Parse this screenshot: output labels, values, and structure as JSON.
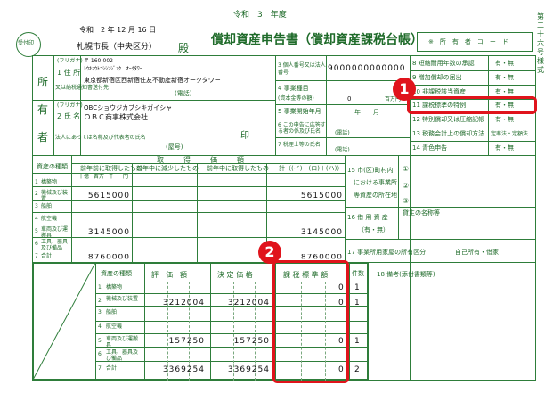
{
  "form": {
    "era_year": "令和　3　年度",
    "title": "償却資産申告書（償却資産課税台帳）",
    "date": "令和　2 年 12 月 16 日",
    "stamp": "受付印",
    "addressee": "札幌市長（中央区分）",
    "honorific": "殿",
    "owner_code_label": "※　所　有　者　コ　ー　ド",
    "side_label": "第二十六号様式"
  },
  "owner": {
    "group_chars": [
      "所",
      "有",
      "者"
    ],
    "address_label": "1 住 所",
    "address_sub": "又は納税通知書送付先",
    "address_furigana": "ﾄｳｷｮｳﾄﾆｼｼﾝｼﾞｭｸ...ｵｰｸﾀﾜｰ",
    "postal": "〒 160-002",
    "address": "東京都新宿区西新宿住友不動産新宿オークタワー",
    "phone_label": "(電話)",
    "name_label": "2 氏 名",
    "name_sub": "法人にあっては名称及び代表者の氏名",
    "name_furigana": "OBCショウジカブシキガイシャ",
    "name": "ＯＢＣ商事株式会社",
    "seal": "印",
    "trade_name_label": "(屋号)",
    "furigana_label": "(フリガナ)"
  },
  "mid": {
    "r3": "3 個人番号又は法人番号",
    "corp_number": "9000000000000",
    "r4": "4 事業種目",
    "r4_sub": "(資本金等の額)",
    "r4_value": "0",
    "r4_unit": "百万円",
    "r5": "5 事業開始年月",
    "r5_value": "年　　月",
    "r6": "6 この申告に応答する者の係及び氏名",
    "r6_sub": "(電話)",
    "r7": "7 税理士等の氏名",
    "r7_sub": "(電話)"
  },
  "right_top": [
    {
      "label": "8 短縮耐用年数の承認",
      "value": "有・無"
    },
    {
      "label": "9 増加償却の届出",
      "value": "有・無"
    },
    {
      "label": "10 非課税該当資産",
      "value": "有・無"
    },
    {
      "label": "11 課税標準の特例",
      "value": "有・無"
    },
    {
      "label": "12 特別償却又は圧縮記帳",
      "value": "有・無"
    },
    {
      "label": "13 税務会計上の償却方法",
      "value": "定率法・定額法"
    },
    {
      "label": "14 青色申告",
      "value": "有・無"
    }
  ],
  "assets": {
    "header_kind": "資産の種類",
    "header_group": "取　　得　　価　　額",
    "col1": "前年前に取得したもの",
    "col2": "前年中に減少したもの",
    "col3": "前年中に取得したもの",
    "col4": "計（(イ)－(ロ)＋(ハ)）",
    "col_marks": [
      "(イ)",
      "(ロ)",
      "(ハ)",
      "(ニ)"
    ],
    "units": [
      "十億",
      "百万",
      "千",
      "円"
    ],
    "rows": [
      {
        "no": "1",
        "kind": "構築物",
        "c1": "",
        "c4": ""
      },
      {
        "no": "2",
        "kind": "機械及び装置",
        "c1": "5615000",
        "c4": "5615000"
      },
      {
        "no": "3",
        "kind": "船舶",
        "c1": "",
        "c4": ""
      },
      {
        "no": "4",
        "kind": "航空機",
        "c1": "",
        "c4": ""
      },
      {
        "no": "5",
        "kind": "車両及び運搬具",
        "c1": "3145000",
        "c4": "3145000"
      },
      {
        "no": "6",
        "kind": "工具、器具及び備品",
        "c1": "",
        "c4": ""
      },
      {
        "no": "7",
        "kind": "合計",
        "c1": "8760000",
        "c4": "8760000"
      }
    ]
  },
  "right_mid": {
    "r15a": "15 市(区)町村内",
    "r15b": "における事業所",
    "r15c": "等資産の所在地",
    "circ1": "①",
    "circ2": "②",
    "circ3": "③",
    "r16": "16 借 用 資 産",
    "r16_value": "（有・無）",
    "r16_lessor": "貸主の名称等",
    "r17": "17 事業所用家屋の所有区分",
    "r17_value": "自己所有・借家",
    "r18": "18 備考(添付書類等)"
  },
  "lower": {
    "header_kind": "資産の種類",
    "col1": "評　価　額",
    "col2": "決 定 価 格",
    "col3": "課 税 標 準 額",
    "col4": "件数",
    "col_marks": [
      "(ホ)",
      "(ヘ)",
      "(ト)"
    ],
    "rows": [
      {
        "no": "1",
        "kind": "構築物",
        "v1": "",
        "v2": "",
        "v3": "0",
        "n": "1"
      },
      {
        "no": "2",
        "kind": "機械及び装置",
        "v1": "3212004",
        "v2": "3212004",
        "v3": "0",
        "n": "1"
      },
      {
        "no": "3",
        "kind": "船舶",
        "v1": "",
        "v2": "",
        "v3": "",
        "n": ""
      },
      {
        "no": "4",
        "kind": "航空機",
        "v1": "",
        "v2": "",
        "v3": "",
        "n": ""
      },
      {
        "no": "5",
        "kind": "車両及び運搬具",
        "v1": "157250",
        "v2": "157250",
        "v3": "0",
        "n": "1"
      },
      {
        "no": "6",
        "kind": "工具、器具及び備品",
        "v1": "",
        "v2": "",
        "v3": "",
        "n": ""
      },
      {
        "no": "7",
        "kind": "合計",
        "v1": "3369254",
        "v2": "3369254",
        "v3": "0",
        "n": "2"
      }
    ]
  },
  "badges": [
    "1",
    "2"
  ],
  "colors": {
    "form_green": "#1f6b2a",
    "highlight_red": "#e0141c"
  }
}
